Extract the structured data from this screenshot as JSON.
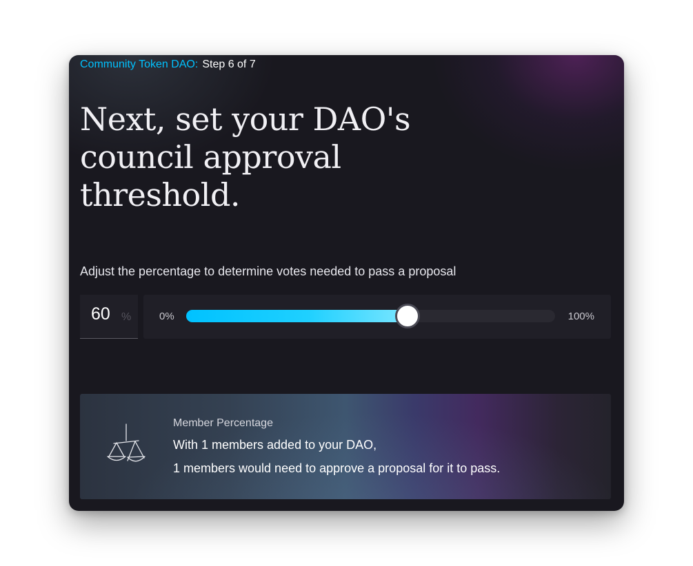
{
  "header": {
    "dao_type": "Community Token DAO:",
    "step": "Step 6 of 7"
  },
  "headline": "Next, set your DAO's council approval threshold.",
  "instruction": "Adjust the percentage to determine votes needed to pass a proposal",
  "threshold": {
    "value": "60",
    "unit": "%",
    "fraction": 0.6,
    "min_label": "0%",
    "max_label": "100%"
  },
  "colors": {
    "accent": "#00c2ff",
    "card_background": "#19181f"
  },
  "info": {
    "icon": "scale-icon",
    "title": "Member Percentage",
    "line1": "With 1 members added to your DAO,",
    "line2": "1 members would need to approve a proposal for it to pass."
  }
}
